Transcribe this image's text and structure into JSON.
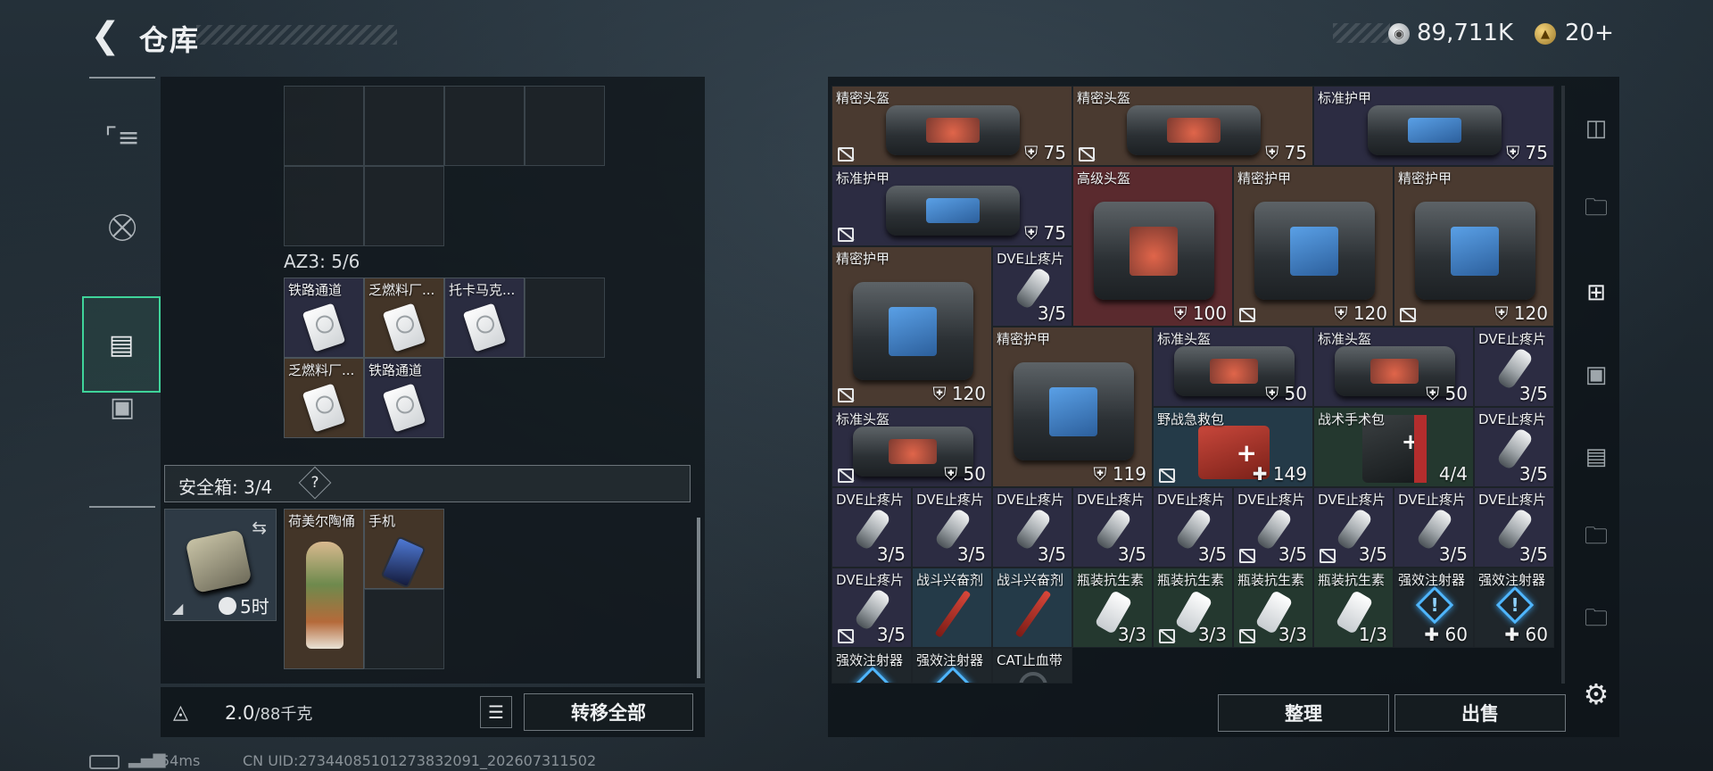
{
  "header": {
    "title": "仓库",
    "currency_1": "89,711K",
    "currency_2": "20+"
  },
  "left_sidebar": {
    "items": [
      {
        "name": "weapon-tab",
        "icon": "pistol-icon"
      },
      {
        "name": "armor-tab",
        "icon": "armor-icon"
      },
      {
        "name": "backpack-tab",
        "icon": "backpack-icon",
        "active": true
      },
      {
        "name": "case-tab",
        "icon": "briefcase-icon"
      }
    ]
  },
  "container": {
    "label": "AZ3: 5/6",
    "items": [
      {
        "name": "铁路通道",
        "icon": "keycard"
      },
      {
        "name": "乏燃料厂...",
        "icon": "keycard"
      },
      {
        "name": "托卡马克...",
        "icon": "keycard"
      },
      {
        "name": "乏燃料厂...",
        "icon": "keycard"
      },
      {
        "name": "铁路通道",
        "icon": "keycard"
      }
    ]
  },
  "safe_box": {
    "label": "安全箱: 3/4",
    "help": "?",
    "timer": "5时",
    "items": [
      {
        "name": "荷美尔陶俑",
        "icon": "figurine"
      },
      {
        "name": "手机",
        "icon": "phone"
      }
    ]
  },
  "bottom_left": {
    "weight_value": "2.0",
    "weight_max": "/88千克",
    "transfer_all_label": "转移全部"
  },
  "stash": {
    "items": [
      {
        "name": "精密头盔",
        "value": "75"
      },
      {
        "name": "精密头盔",
        "value": "75"
      },
      {
        "name": "标准护甲",
        "value": "75"
      },
      {
        "name": "标准护甲",
        "value": "75"
      },
      {
        "name": "高级头盔",
        "value": "100"
      },
      {
        "name": "精密护甲",
        "value": "120"
      },
      {
        "name": "精密护甲",
        "value": "120"
      },
      {
        "name": "精密护甲",
        "value": "120"
      },
      {
        "name": "DVE止疼片",
        "value": "3/5"
      },
      {
        "name": "精密护甲",
        "value": "119"
      },
      {
        "name": "标准头盔",
        "value": "50"
      },
      {
        "name": "标准头盔",
        "value": "50"
      },
      {
        "name": "DVE止疼片",
        "value": "3/5"
      },
      {
        "name": "标准头盔",
        "value": "50"
      },
      {
        "name": "野战急救包",
        "value": "149"
      },
      {
        "name": "战术手术包",
        "value": "4/4"
      },
      {
        "name": "DVE止疼片",
        "value": "3/5"
      },
      {
        "name": "DVE止疼片",
        "value": "3/5"
      },
      {
        "name": "DVE止疼片",
        "value": "3/5"
      },
      {
        "name": "DVE止疼片",
        "value": "3/5"
      },
      {
        "name": "DVE止疼片",
        "value": "3/5"
      },
      {
        "name": "DVE止疼片",
        "value": "3/5"
      },
      {
        "name": "DVE止疼片",
        "value": "3/5"
      },
      {
        "name": "DVE止疼片",
        "value": "3/5"
      },
      {
        "name": "DVE止疼片",
        "value": "3/5"
      },
      {
        "name": "DVE止疼片",
        "value": "3/5"
      },
      {
        "name": "DVE止疼片",
        "value": "3/5"
      },
      {
        "name": "战斗兴奋剂",
        "value": ""
      },
      {
        "name": "战斗兴奋剂",
        "value": ""
      },
      {
        "name": "瓶装抗生素",
        "value": "3/3"
      },
      {
        "name": "瓶装抗生素",
        "value": "3/3"
      },
      {
        "name": "瓶装抗生素",
        "value": "3/3"
      },
      {
        "name": "瓶装抗生素",
        "value": "1/3"
      },
      {
        "name": "强效注射器",
        "value": "60"
      },
      {
        "name": "强效注射器",
        "value": "60"
      },
      {
        "name": "强效注射器",
        "value": ""
      },
      {
        "name": "强效注射器",
        "value": ""
      },
      {
        "name": "CAT止血带",
        "value": ""
      }
    ],
    "organize_label": "整理",
    "sell_label": "出售"
  },
  "right_sidebar": {
    "items": [
      "backpack-icon",
      "folder-iv-icon",
      "folder-iv-add-icon",
      "folder-iv-camera-icon",
      "folder-iv-ticket-icon",
      "folder-iv-icon",
      "folder-iv-icon"
    ]
  },
  "status_bar": {
    "ping": "54ms",
    "uid": "CN UID:27344085101273832091_202607311502"
  },
  "colors": {
    "accent_green": "#3fd49a",
    "cell_brown": "#4a3a30",
    "cell_purple": "#2c2c42",
    "cell_red": "#5a2a2e",
    "cell_blue": "#243a48",
    "cell_green": "#24382f"
  }
}
